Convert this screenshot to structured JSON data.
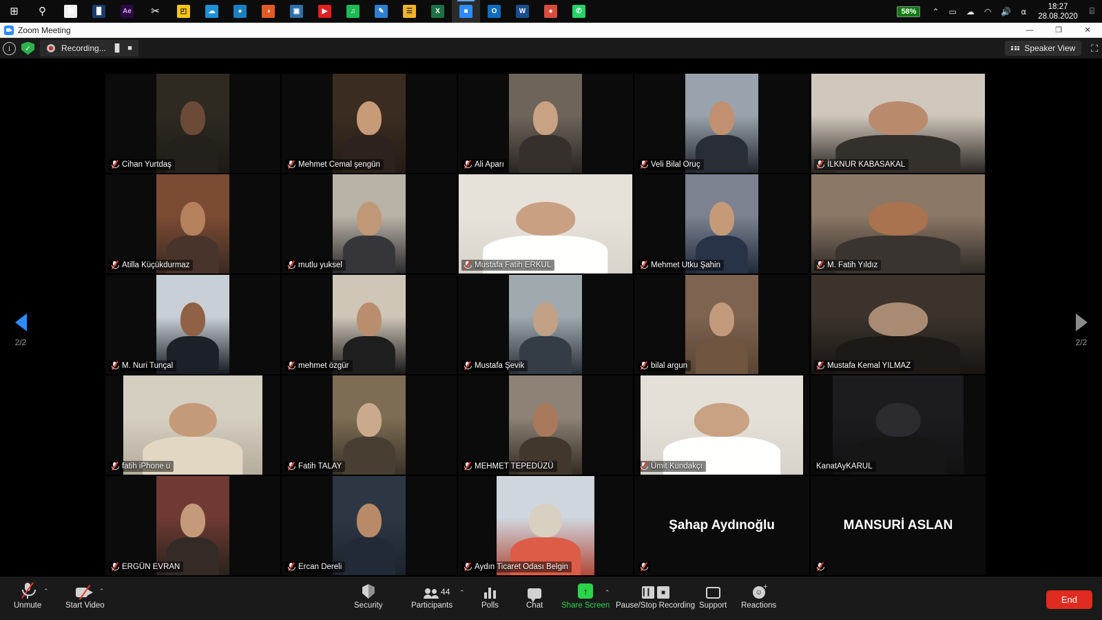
{
  "taskbar": {
    "apps": [
      {
        "name": "start-button",
        "glyph": "⊞",
        "color": "#ffffff",
        "bg": "transparent"
      },
      {
        "name": "search-icon",
        "glyph": "⚲",
        "color": "#ffffff",
        "bg": "transparent"
      },
      {
        "name": "microsoft-store-icon",
        "glyph": "⊞",
        "color": "#ffffff",
        "bg": "#f2f2f2"
      },
      {
        "name": "power-bi-icon",
        "glyph": "█",
        "color": "#ffffff",
        "bg": "#1a3d6e"
      },
      {
        "name": "after-effects-icon",
        "glyph": "Ae",
        "color": "#d9aaff",
        "bg": "#2a0a40"
      },
      {
        "name": "snipping-tool-icon",
        "glyph": "✂",
        "color": "#ffffff",
        "bg": "transparent"
      },
      {
        "name": "sticky-notes-icon",
        "glyph": "◰",
        "color": "#1a1a1a",
        "bg": "#f5c518"
      },
      {
        "name": "onedrive-icon",
        "glyph": "☁",
        "color": "#ffffff",
        "bg": "#1e90d6"
      },
      {
        "name": "microsoft-edge-icon",
        "glyph": "●",
        "color": "#ffffff",
        "bg": "#1a7fc1"
      },
      {
        "name": "firefox-icon",
        "glyph": "◑",
        "color": "#ffffff",
        "bg": "#e25b26"
      },
      {
        "name": "remote-desktop-icon",
        "glyph": "▣",
        "color": "#ffffff",
        "bg": "#2f6fa8"
      },
      {
        "name": "youtube-icon",
        "glyph": "▶",
        "color": "#ffffff",
        "bg": "#e02020"
      },
      {
        "name": "spotify-icon",
        "glyph": "♫",
        "color": "#ffffff",
        "bg": "#1db954"
      },
      {
        "name": "paint-icon",
        "glyph": "✎",
        "color": "#ffffff",
        "bg": "#2d7fd0"
      },
      {
        "name": "file-explorer-icon",
        "glyph": "☰",
        "color": "#2a2a2a",
        "bg": "#f0b429"
      },
      {
        "name": "excel-icon",
        "glyph": "X",
        "color": "#ffffff",
        "bg": "#1d7044"
      },
      {
        "name": "zoom-icon",
        "glyph": "■",
        "color": "#ffffff",
        "bg": "#2d8cff",
        "active": true
      },
      {
        "name": "outlook-icon",
        "glyph": "O",
        "color": "#ffffff",
        "bg": "#0f6cbd"
      },
      {
        "name": "word-icon",
        "glyph": "W",
        "color": "#ffffff",
        "bg": "#1b4d8f"
      },
      {
        "name": "chrome-icon",
        "glyph": "●",
        "color": "#ffffff",
        "bg": "#d94c3d"
      },
      {
        "name": "whatsapp-icon",
        "glyph": "✆",
        "color": "#ffffff",
        "bg": "#25d366"
      }
    ],
    "tray": {
      "battery_percent": "58%",
      "show_hidden_icons": "⌃",
      "battery_icon": "▭",
      "onedrive_icon": "☁",
      "network_icon": "◠",
      "volume_icon": "ὐA",
      "bluetooth_icon": "ʙ",
      "time": "18:27",
      "date": "28.08.2020",
      "action_center_icon": "⌸"
    }
  },
  "window": {
    "title": "Zoom Meeting",
    "minimize": "—",
    "maximize": "❐",
    "close": "✕"
  },
  "header": {
    "info_icon": "i",
    "encryption_icon": "✓",
    "recording_label": "Recording...",
    "pause_icon": "▐▌",
    "stop_icon": "■",
    "speaker_view_label": "Speaker View",
    "fullscreen_icon": "⤢"
  },
  "gallery": {
    "page_left_label": "2/2",
    "page_right_label": "2/2",
    "participants": [
      {
        "name": "Cihan Yurtdaş",
        "muted": true,
        "video": true,
        "skin": "#6b4a38",
        "bg": "#1d1a16",
        "wall": "#2e2a22",
        "vw": 106
      },
      {
        "name": "Mehmet Cemal şengün",
        "muted": true,
        "video": true,
        "skin": "#c79a78",
        "bg": "#241c18",
        "wall": "#3a2c20",
        "vw": 106
      },
      {
        "name": "Ali Aparı",
        "muted": true,
        "video": true,
        "skin": "#c9a183",
        "bg": "#2b2623",
        "wall": "#6d655a",
        "vw": 106
      },
      {
        "name": "Veli Bilal Oruç",
        "muted": true,
        "video": true,
        "skin": "#c09070",
        "bg": "#20242b",
        "wall": "#9aa3ad",
        "vw": 106
      },
      {
        "name": "İLKNUR KABASAKAL",
        "muted": true,
        "video": true,
        "skin": "#b98a6c",
        "bg": "#2a2623",
        "wall": "#cfc7bb",
        "vw": 252
      },
      {
        "name": "Atilla Küçükdurmaz",
        "muted": true,
        "video": true,
        "skin": "#b5815c",
        "bg": "#3a2a22",
        "wall": "#7b4b33",
        "vw": 106
      },
      {
        "name": "mutlu yuksel",
        "muted": true,
        "video": true,
        "skin": "#c09878",
        "bg": "#2b2b2e",
        "wall": "#b9b2a6",
        "vw": 106
      },
      {
        "name": "Mustafa Fatih ERKUL",
        "muted": true,
        "video": true,
        "skin": "#caa083",
        "bg": "#d8d3cb",
        "wall": "#e6e2da",
        "vw": 252
      },
      {
        "name": "Mehmet Utku Şahin",
        "muted": true,
        "video": true,
        "skin": "#c49a78",
        "bg": "#20293a",
        "wall": "#7c8290",
        "vw": 106
      },
      {
        "name": "M. Fatih Yıldız",
        "muted": true,
        "video": true,
        "skin": "#a9734f",
        "bg": "#2e2a26",
        "wall": "#8b7866",
        "vw": 252
      },
      {
        "name": "M. Nuri Tunçal",
        "muted": true,
        "video": true,
        "skin": "#8f6246",
        "bg": "#161a20",
        "wall": "#c9cfd6",
        "vw": 106
      },
      {
        "name": "mehmet özgür",
        "muted": true,
        "video": true,
        "skin": "#b98e6e",
        "bg": "#181818",
        "wall": "#cfc6b8",
        "vw": 106
      },
      {
        "name": "Mustafa Şevik",
        "muted": true,
        "video": true,
        "skin": "#c2a186",
        "bg": "#2a3038",
        "wall": "#9fa9ae",
        "vw": 106
      },
      {
        "name": "bilal argun",
        "muted": true,
        "video": true,
        "skin": "#c49a7c",
        "bg": "#5a4434",
        "wall": "#7d6350",
        "vw": 106
      },
      {
        "name": "Mustafa Kemal YILMAZ",
        "muted": true,
        "video": true,
        "skin": "#a98b74",
        "bg": "#171412",
        "wall": "#3b332c",
        "vw": 252
      },
      {
        "name": "fatih iPhone u",
        "muted": true,
        "video": true,
        "skin": "#c59a78",
        "bg": "#b4ac9c",
        "wall": "#d5cfc2",
        "vw": 202
      },
      {
        "name": "Fatih TALAY",
        "muted": true,
        "video": true,
        "skin": "#cba98c",
        "bg": "#3a3228",
        "wall": "#7d6d54",
        "vw": 106
      },
      {
        "name": "MEHMET TEPEDÜZÜ",
        "muted": true,
        "video": true,
        "skin": "#a8795a",
        "bg": "#342c24",
        "wall": "#8d8275",
        "vw": 106
      },
      {
        "name": "Ümit Kundakçı",
        "muted": true,
        "video": true,
        "skin": "#c9a183",
        "bg": "#d7d3cb",
        "wall": "#e4e0d8",
        "vw": 236
      },
      {
        "name": "KanatAyKARUL",
        "muted": false,
        "video": true,
        "skin": "#2b2b30",
        "bg": "#121212",
        "wall": "#1c1c20",
        "vw": 190
      },
      {
        "name": "ERGÜN EVRAN",
        "muted": true,
        "video": true,
        "skin": "#c59a7a",
        "bg": "#2a221e",
        "wall": "#6e3a32",
        "vw": 106
      },
      {
        "name": "Ercan Dereli",
        "muted": true,
        "video": true,
        "skin": "#b88a68",
        "bg": "#1b222c",
        "wall": "#2d3744",
        "vw": 106
      },
      {
        "name": "Aydın Ticaret Odası Belgin",
        "muted": true,
        "video": true,
        "skin": "#d8d0c0",
        "bg": "#b04a3a",
        "wall": "#cfd6de",
        "vw": 142
      },
      {
        "name": "Şahap Aydınoğlu",
        "muted": true,
        "video": false,
        "display": "Şahap Aydınoğlu"
      },
      {
        "name": "MANSURİ ASLAN",
        "muted": true,
        "video": false,
        "display": "MANSURİ ASLAN"
      }
    ]
  },
  "toolbar": {
    "unmute_label": "Unmute",
    "start_video_label": "Start Video",
    "security_label": "Security",
    "participants_label": "Participants",
    "participants_count": "44",
    "polls_label": "Polls",
    "chat_label": "Chat",
    "share_screen_label": "Share Screen",
    "pause_stop_recording_label": "Pause/Stop Recording",
    "support_label": "Support",
    "reactions_label": "Reactions",
    "end_label": "End",
    "caret": "⌃"
  },
  "colors": {
    "accent_blue": "#2d8cff",
    "end_red": "#e02b20",
    "share_green": "#2bd44b",
    "mute_red": "#e8392f",
    "battery_green": "#107c10"
  }
}
